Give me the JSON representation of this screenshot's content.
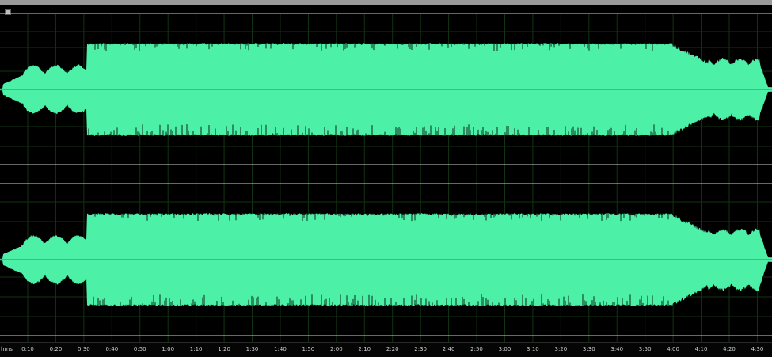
{
  "editor": {
    "channels": [
      "left",
      "right"
    ],
    "waveform_color": "#4cf0a6",
    "background_color": "#000000",
    "grid_color": "#123312"
  },
  "ruler": {
    "unit_label": "hms",
    "ticks": [
      "0:10",
      "0:20",
      "0:30",
      "0:40",
      "0:50",
      "1:00",
      "1:10",
      "1:20",
      "1:30",
      "1:40",
      "1:50",
      "2:00",
      "2:10",
      "2:20",
      "2:30",
      "2:40",
      "2:50",
      "3:00",
      "3:10",
      "3:20",
      "3:30",
      "3:40",
      "3:50",
      "4:00",
      "4:10",
      "4:20",
      "4:30"
    ]
  }
}
